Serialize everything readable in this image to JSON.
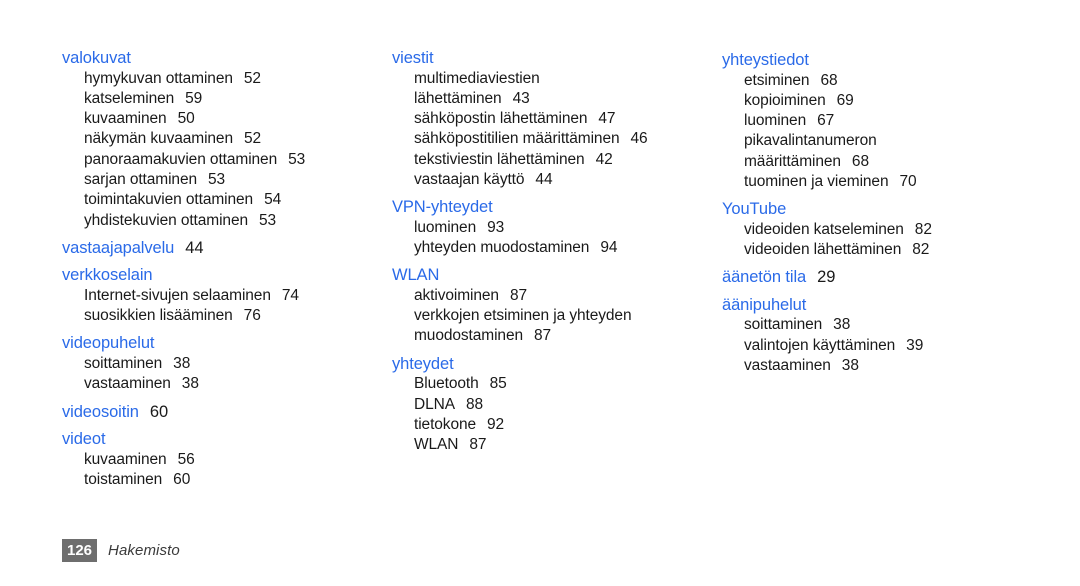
{
  "document": {
    "type": "index-page",
    "language": "fi",
    "heading_color": "#2a6ae8",
    "text_color": "#1a1a1a",
    "background_color": "#ffffff",
    "footer_badge_color": "#6e6e6e"
  },
  "columns": [
    {
      "id": "column-1",
      "groups": [
        {
          "heading": "valokuvat",
          "heading_page": "",
          "entries": [
            {
              "label": "hymykuvan ottaminen",
              "page": "52"
            },
            {
              "label": "katseleminen",
              "page": "59"
            },
            {
              "label": "kuvaaminen",
              "page": "50"
            },
            {
              "label": "näkymän kuvaaminen",
              "page": "52"
            },
            {
              "label": "panoraamakuvien ottaminen",
              "page": "53"
            },
            {
              "label": "sarjan ottaminen",
              "page": "53"
            },
            {
              "label": "toimintakuvien ottaminen",
              "page": "54"
            },
            {
              "label": "yhdistekuvien ottaminen",
              "page": "53"
            }
          ]
        },
        {
          "heading": "vastaajapalvelu",
          "heading_page": "44",
          "entries": []
        },
        {
          "heading": "verkkoselain",
          "heading_page": "",
          "entries": [
            {
              "label": "Internet-sivujen selaaminen",
              "page": "74"
            },
            {
              "label": "suosikkien lisääminen",
              "page": "76"
            }
          ]
        },
        {
          "heading": "videopuhelut",
          "heading_page": "",
          "entries": [
            {
              "label": "soittaminen",
              "page": "38"
            },
            {
              "label": "vastaaminen",
              "page": "38"
            }
          ]
        },
        {
          "heading": "videosoitin",
          "heading_page": "60",
          "entries": []
        },
        {
          "heading": "videot",
          "heading_page": "",
          "entries": [
            {
              "label": "kuvaaminen",
              "page": "56"
            },
            {
              "label": "toistaminen",
              "page": "60"
            }
          ]
        }
      ]
    },
    {
      "id": "column-2",
      "groups": [
        {
          "heading": "viestit",
          "heading_page": "",
          "entries": [
            {
              "label": "multimediaviestien",
              "page": ""
            },
            {
              "label": "lähettäminen",
              "page": "43"
            },
            {
              "label": "sähköpostin lähettäminen",
              "page": "47"
            },
            {
              "label": "sähköpostitilien määrittäminen",
              "page": "46"
            },
            {
              "label": "tekstiviestin lähettäminen",
              "page": "42"
            },
            {
              "label": "vastaajan käyttö",
              "page": "44"
            }
          ]
        },
        {
          "heading": "VPN-yhteydet",
          "heading_page": "",
          "entries": [
            {
              "label": "luominen",
              "page": "93"
            },
            {
              "label": "yhteyden muodostaminen",
              "page": "94"
            }
          ]
        },
        {
          "heading": "WLAN",
          "heading_page": "",
          "entries": [
            {
              "label": "aktivoiminen",
              "page": "87"
            },
            {
              "label": "verkkojen etsiminen ja yhteyden",
              "page": ""
            },
            {
              "label": "muodostaminen",
              "page": "87"
            }
          ]
        },
        {
          "heading": "yhteydet",
          "heading_page": "",
          "entries": [
            {
              "label": "Bluetooth",
              "page": "85"
            },
            {
              "label": "DLNA",
              "page": "88"
            },
            {
              "label": "tietokone",
              "page": "92"
            },
            {
              "label": "WLAN",
              "page": "87"
            }
          ]
        }
      ]
    },
    {
      "id": "column-3",
      "groups": [
        {
          "heading": "yhteystiedot",
          "heading_page": "",
          "entries": [
            {
              "label": "etsiminen",
              "page": "68"
            },
            {
              "label": "kopioiminen",
              "page": "69"
            },
            {
              "label": "luominen",
              "page": "67"
            },
            {
              "label": "pikavalintanumeron",
              "page": ""
            },
            {
              "label": "määrittäminen",
              "page": "68"
            },
            {
              "label": "tuominen ja vieminen",
              "page": "70"
            }
          ]
        },
        {
          "heading": "YouTube",
          "heading_page": "",
          "entries": [
            {
              "label": "videoiden katseleminen",
              "page": "82"
            },
            {
              "label": "videoiden lähettäminen",
              "page": "82"
            }
          ]
        },
        {
          "heading": "äänetön tila",
          "heading_page": "29",
          "entries": []
        },
        {
          "heading": "äänipuhelut",
          "heading_page": "",
          "entries": [
            {
              "label": "soittaminen",
              "page": "38"
            },
            {
              "label": "valintojen käyttäminen",
              "page": "39"
            },
            {
              "label": "vastaaminen",
              "page": "38"
            }
          ]
        }
      ]
    }
  ],
  "footer": {
    "page_number": "126",
    "label": "Hakemisto"
  }
}
